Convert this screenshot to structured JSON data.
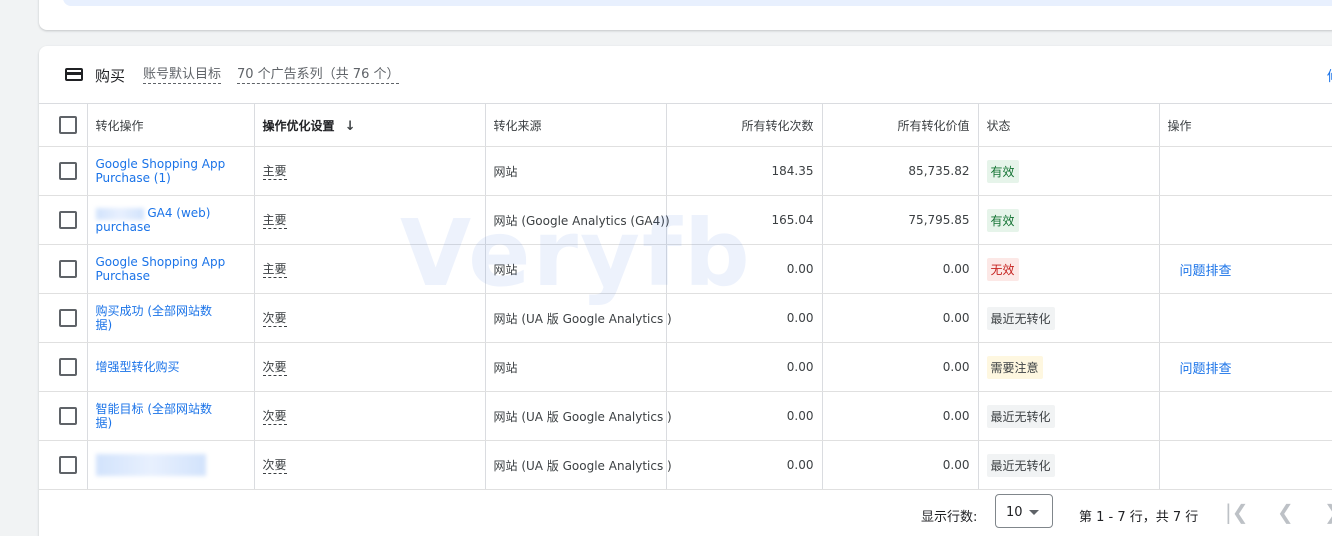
{
  "header": {
    "title": "购买",
    "account_goal_link": "账号默认目标",
    "campaigns_link": "70 个广告系列（共 76 个）",
    "corner_char": "修"
  },
  "table": {
    "columns": {
      "action": "转化操作",
      "optimization": "操作优化设置",
      "source": "转化来源",
      "all_conversions": "所有转化次数",
      "all_value": "所有转化价值",
      "status": "状态",
      "ops": "操作"
    },
    "sort_icon": "arrow-down-icon",
    "rows": [
      {
        "name": "Google Shopping App Purchase (1)",
        "optimization": "主要",
        "source": "网站",
        "conversions": "184.35",
        "value": "85,735.82",
        "status": "有效",
        "status_kind": "green",
        "action": ""
      },
      {
        "name": "GA4 (web) purchase",
        "optimization": "主要",
        "source": "网站 (Google Analytics (GA4))",
        "conversions": "165.04",
        "value": "75,795.85",
        "status": "有效",
        "status_kind": "green",
        "action": ""
      },
      {
        "name": "Google Shopping App Purchase",
        "optimization": "主要",
        "source": "网站",
        "conversions": "0.00",
        "value": "0.00",
        "status": "无效",
        "status_kind": "red",
        "action": "问题排查"
      },
      {
        "name": "购买成功 (全部网站数据)",
        "optimization": "次要",
        "source": "网站 (UA 版 Google Analytics )",
        "conversions": "0.00",
        "value": "0.00",
        "status": "最近无转化",
        "status_kind": "grey",
        "action": ""
      },
      {
        "name": "增强型转化购买",
        "optimization": "次要",
        "source": "网站",
        "conversions": "0.00",
        "value": "0.00",
        "status": "需要注意",
        "status_kind": "yellow",
        "action": "问题排查"
      },
      {
        "name": "智能目标 (全部网站数据)",
        "optimization": "次要",
        "source": "网站 (UA 版 Google Analytics )",
        "conversions": "0.00",
        "value": "0.00",
        "status": "最近无转化",
        "status_kind": "grey",
        "action": ""
      },
      {
        "name": "",
        "optimization": "次要",
        "source": "网站 (UA 版 Google Analytics )",
        "conversions": "0.00",
        "value": "0.00",
        "status": "最近无转化",
        "status_kind": "grey",
        "action": ""
      }
    ]
  },
  "footer": {
    "rows_label": "显示行数:",
    "rows_value": "10",
    "page_info": "第 1 - 7 行，共 7 行"
  },
  "watermark": "Veryfb",
  "colors": {
    "link": "#1a73e8",
    "status_green": "#137333",
    "status_red": "#c5221f"
  }
}
